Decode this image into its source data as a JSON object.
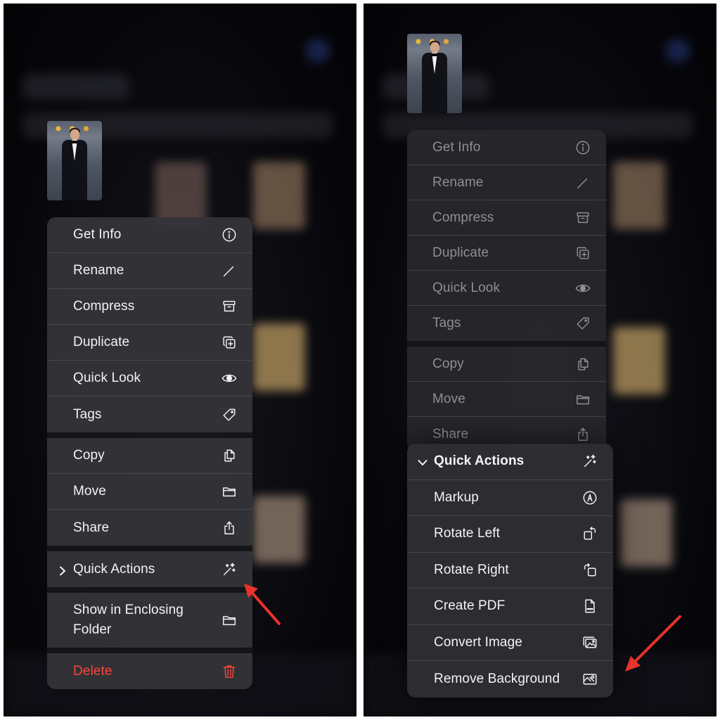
{
  "colors": {
    "menu_text": "#f2f2f7",
    "dimmed_text": "#8e8e93",
    "destructive": "#ff453a",
    "annotation_arrow": "#e8322a"
  },
  "left_menu": {
    "group1": [
      {
        "label": "Get Info",
        "icon": "info-circle-icon"
      },
      {
        "label": "Rename",
        "icon": "pencil-icon"
      },
      {
        "label": "Compress",
        "icon": "archive-box-icon"
      },
      {
        "label": "Duplicate",
        "icon": "duplicate-plus-icon"
      },
      {
        "label": "Quick Look",
        "icon": "eye-icon"
      },
      {
        "label": "Tags",
        "icon": "tag-icon"
      }
    ],
    "group2": [
      {
        "label": "Copy",
        "icon": "copy-doc-icon"
      },
      {
        "label": "Move",
        "icon": "folder-icon"
      },
      {
        "label": "Share",
        "icon": "share-icon"
      }
    ],
    "quick_actions": {
      "label": "Quick Actions",
      "icon": "magic-wand-icon"
    },
    "show_in_folder": {
      "label": "Show in Enclosing Folder",
      "icon": "folder-icon"
    },
    "delete": {
      "label": "Delete",
      "icon": "trash-icon"
    }
  },
  "right_menu": {
    "group1": [
      {
        "label": "Get Info",
        "icon": "info-circle-icon"
      },
      {
        "label": "Rename",
        "icon": "pencil-icon"
      },
      {
        "label": "Compress",
        "icon": "archive-box-icon"
      },
      {
        "label": "Duplicate",
        "icon": "duplicate-plus-icon"
      },
      {
        "label": "Quick Look",
        "icon": "eye-icon"
      },
      {
        "label": "Tags",
        "icon": "tag-icon"
      }
    ],
    "group2": [
      {
        "label": "Copy",
        "icon": "copy-doc-icon"
      },
      {
        "label": "Move",
        "icon": "folder-icon"
      },
      {
        "label": "Share",
        "icon": "share-icon"
      }
    ]
  },
  "quick_actions_submenu": {
    "header": {
      "label": "Quick Actions",
      "icon": "magic-wand-icon"
    },
    "items": [
      {
        "label": "Markup",
        "icon": "markup-pen-icon"
      },
      {
        "label": "Rotate Left",
        "icon": "rotate-left-icon"
      },
      {
        "label": "Rotate Right",
        "icon": "rotate-right-icon"
      },
      {
        "label": "Create PDF",
        "icon": "pdf-doc-icon"
      },
      {
        "label": "Convert Image",
        "icon": "photos-icon"
      },
      {
        "label": "Remove Background",
        "icon": "remove-background-icon"
      }
    ]
  }
}
